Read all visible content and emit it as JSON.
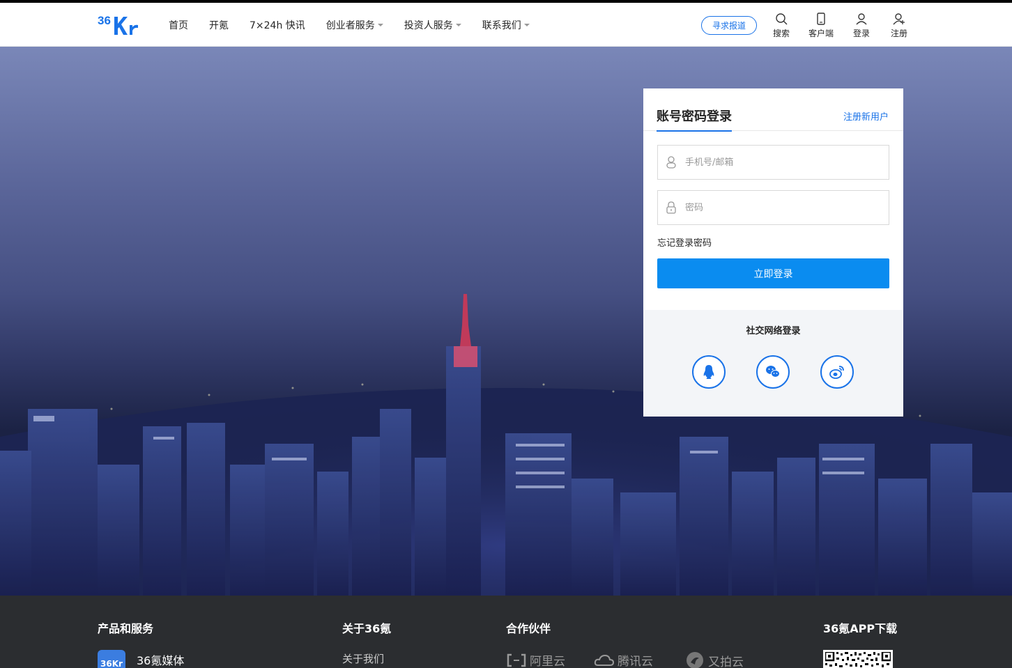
{
  "header": {
    "logo_text": "36Kr",
    "nav": [
      {
        "label": "首页",
        "dropdown": false
      },
      {
        "label": "开氪",
        "dropdown": false
      },
      {
        "label": "7×24h 快讯",
        "dropdown": false
      },
      {
        "label": "创业者服务",
        "dropdown": true
      },
      {
        "label": "投资人服务",
        "dropdown": true
      },
      {
        "label": "联系我们",
        "dropdown": true
      }
    ],
    "report_button": "寻求报道",
    "tools": {
      "search": "搜索",
      "client": "客户端",
      "login": "登录",
      "register": "注册"
    }
  },
  "login_card": {
    "title": "账号密码登录",
    "register_link": "注册新用户",
    "account_placeholder": "手机号/邮箱",
    "password_placeholder": "密码",
    "forgot": "忘记登录密码",
    "submit": "立即登录",
    "social_title": "社交网络登录",
    "social": [
      "qq-icon",
      "wechat-icon",
      "weibo-icon"
    ]
  },
  "footer": {
    "products_heading": "产品和服务",
    "product_icon_text": "36Kr",
    "product_label": "36氪媒体",
    "about_heading": "关于36氪",
    "about_link": "关于我们",
    "partners_heading": "合作伙伴",
    "partners": [
      "阿里云",
      "腾讯云",
      "又拍云"
    ],
    "app_heading": "36氪APP下载"
  },
  "colors": {
    "accent": "#1a73e8",
    "button": "#0a8cf0",
    "footer_bg": "#2b2d30",
    "social_bg": "#f3f5f8"
  }
}
